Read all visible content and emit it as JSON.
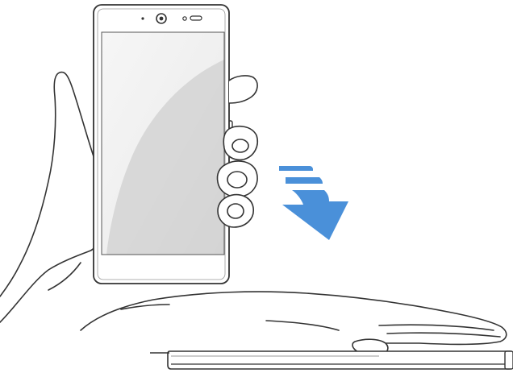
{
  "illustration": {
    "subject": "phone-flip-down-gesture",
    "elements": [
      "hand-holding-phone",
      "phone-upright",
      "down-arrow-indicator",
      "hand-resting-on-phone",
      "phone-face-down"
    ]
  },
  "colors": {
    "arrow": "#4a90d9",
    "outline": "#333333",
    "screen_light": "#f2f2f2",
    "screen_dark": "#cfcfcf"
  },
  "icons": {
    "arrow": "down-arrow-icon",
    "camera": "front-camera-icon",
    "sensor": "sensor-icon",
    "speaker": "speaker-icon"
  }
}
